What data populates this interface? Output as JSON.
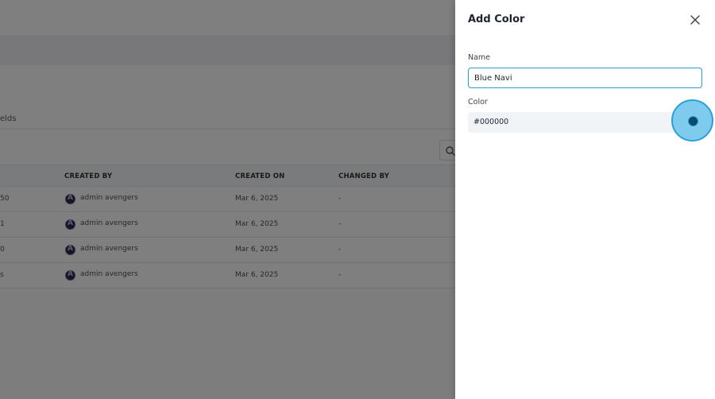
{
  "background": {
    "tab_fragment": "elds",
    "table": {
      "columns": [
        "CREATED BY",
        "CREATED ON",
        "CHANGED BY"
      ],
      "rows": [
        {
          "first": "50",
          "created_by": "admin avengers",
          "created_on": "Mar 6, 2025",
          "changed_by": "-"
        },
        {
          "first": "1",
          "created_by": "admin avengers",
          "created_on": "Mar 6, 2025",
          "changed_by": "-"
        },
        {
          "first": "0",
          "created_by": "admin avengers",
          "created_on": "Mar 6, 2025",
          "changed_by": "-"
        },
        {
          "first": "s",
          "created_by": "admin avengers",
          "created_on": "Mar 6, 2025",
          "changed_by": "-"
        }
      ]
    }
  },
  "drawer": {
    "title": "Add Color",
    "name_label": "Name",
    "name_value": "Blue Navi",
    "color_label": "Color",
    "color_value": "#000000"
  },
  "colors": {
    "accent": "#2aa0c8",
    "swatch": "#0a4a6b",
    "overlay": "rgba(0,0,0,0.5)"
  },
  "icons": {
    "close": "close-icon",
    "search": "search-icon",
    "avatar": "avatar"
  }
}
